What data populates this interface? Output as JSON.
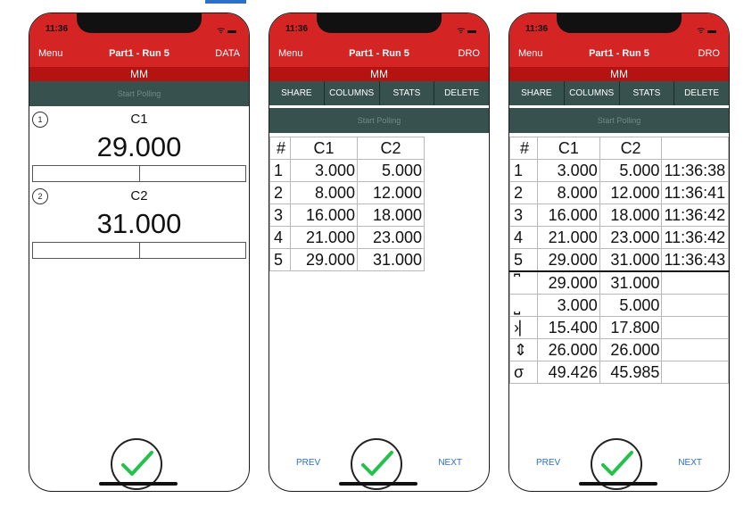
{
  "status_time": "11:36",
  "status_icons": "ᯤ ▬",
  "units": "MM",
  "start_polling": "Start Polling",
  "accept_icon": "checkmark-icon",
  "screen1": {
    "nav": {
      "left": "Menu",
      "title": "Part1 - Run 5",
      "right": "DATA"
    },
    "channels": [
      {
        "num": "1",
        "name": "C1",
        "value": "29.000"
      },
      {
        "num": "2",
        "name": "C2",
        "value": "31.000"
      }
    ]
  },
  "screen2": {
    "nav": {
      "left": "Menu",
      "title": "Part1 - Run 5",
      "right": "DRO"
    },
    "toolbar": [
      "SHARE",
      "COLUMNS",
      "STATS",
      "DELETE"
    ],
    "headers": [
      "#",
      "C1",
      "C2"
    ],
    "rows": [
      [
        "1",
        "3.000",
        "5.000"
      ],
      [
        "2",
        "8.000",
        "12.000"
      ],
      [
        "3",
        "16.000",
        "18.000"
      ],
      [
        "4",
        "21.000",
        "23.000"
      ],
      [
        "5",
        "29.000",
        "31.000"
      ]
    ],
    "prev": "PREV",
    "next": "NEXT"
  },
  "screen3": {
    "nav": {
      "left": "Menu",
      "title": "Part1 - Run 5",
      "right": "DRO"
    },
    "toolbar": [
      "SHARE",
      "COLUMNS",
      "STATS",
      "DELETE"
    ],
    "headers": [
      "#",
      "C1",
      "C2",
      ""
    ],
    "rows": [
      [
        "1",
        "3.000",
        "5.000",
        "11:36:38"
      ],
      [
        "2",
        "8.000",
        "12.000",
        "11:36:41"
      ],
      [
        "3",
        "16.000",
        "18.000",
        "11:36:42"
      ],
      [
        "4",
        "21.000",
        "23.000",
        "11:36:42"
      ],
      [
        "5",
        "29.000",
        "31.000",
        "11:36:43"
      ]
    ],
    "stats": [
      {
        "symbol": "⎴",
        "icon": "max-icon",
        "c1": "29.000",
        "c2": "31.000"
      },
      {
        "symbol": "⎵",
        "icon": "min-icon",
        "c1": "3.000",
        "c2": "5.000"
      },
      {
        "symbol": "›⎸",
        "icon": "mean-icon",
        "c1": "15.400",
        "c2": "17.800"
      },
      {
        "symbol": "⇕",
        "icon": "range-icon",
        "c1": "26.000",
        "c2": "26.000"
      },
      {
        "symbol": "σ",
        "icon": "sigma-icon",
        "c1": "49.426",
        "c2": "45.985"
      }
    ],
    "prev": "PREV",
    "next": "NEXT"
  }
}
